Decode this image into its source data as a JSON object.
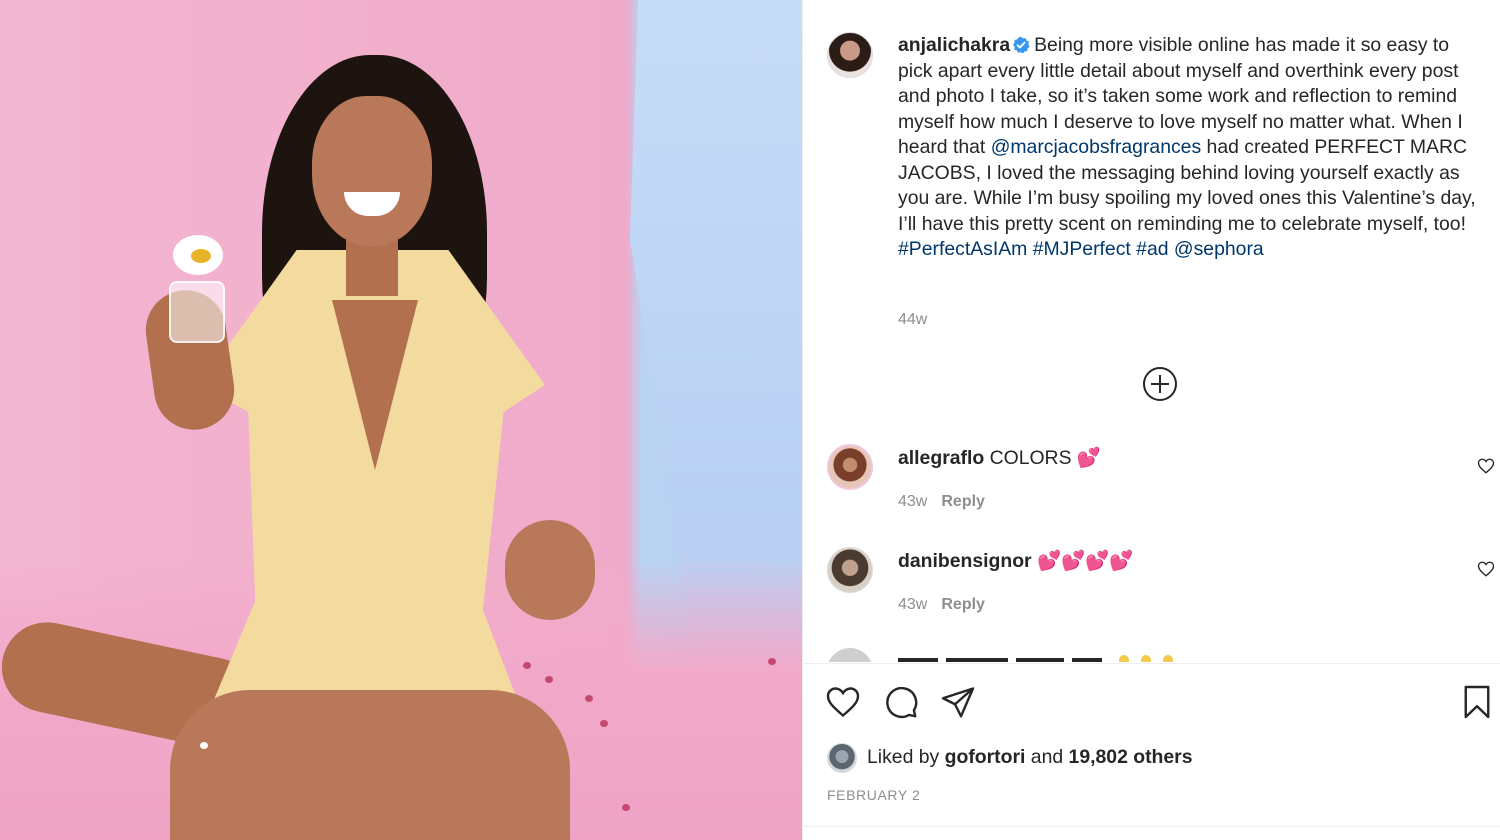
{
  "post": {
    "username": "anjalichakra",
    "verified": true,
    "caption_segments": [
      {
        "type": "text",
        "value": "Being more visible online has made it so easy to pick apart every little detail about myself and overthink every post and photo I take, so it’s taken some work and reflection to remind myself how much I deserve to love myself no matter what. When I heard that "
      },
      {
        "type": "mention",
        "value": "@marcjacobsfragrances"
      },
      {
        "type": "text",
        "value": " had created PERFECT MARC JACOBS, I loved the messaging behind loving yourself exactly as you are. While I’m busy spoiling my loved ones this Valentine’s day, I’ll have this pretty scent on reminding me to celebrate myself, too! "
      },
      {
        "type": "tag",
        "value": "#PerfectAsIAm"
      },
      {
        "type": "text",
        "value": " "
      },
      {
        "type": "tag",
        "value": "#MJPerfect"
      },
      {
        "type": "text",
        "value": " "
      },
      {
        "type": "tag",
        "value": "#ad"
      },
      {
        "type": "text",
        "value": " "
      },
      {
        "type": "mention",
        "value": "@sephora"
      }
    ],
    "caption_time": "44w",
    "date": "FEBRUARY 2"
  },
  "load_more": {
    "icon": "plus-circle-icon"
  },
  "comments": [
    {
      "username": "allegraflo",
      "text": "COLORS 💕",
      "time": "43w",
      "reply_label": "Reply"
    },
    {
      "username": "danibensignor",
      "text": "💕💕💕💕",
      "time": "43w",
      "reply_label": "Reply"
    }
  ],
  "actions": {
    "like_icon": "heart-icon",
    "comment_icon": "comment-bubble-icon",
    "share_icon": "paper-plane-icon",
    "save_icon": "bookmark-icon"
  },
  "likes": {
    "prefix": "Liked by",
    "user": "gofortori",
    "conjunction": "and",
    "others": "19,802 others"
  },
  "colors": {
    "link": "#00376b",
    "meta": "#8e8e8e",
    "text": "#262626",
    "verified": "#3897f0",
    "photo_pink": "#f1aecb",
    "photo_blue": "#b8d0f3"
  }
}
